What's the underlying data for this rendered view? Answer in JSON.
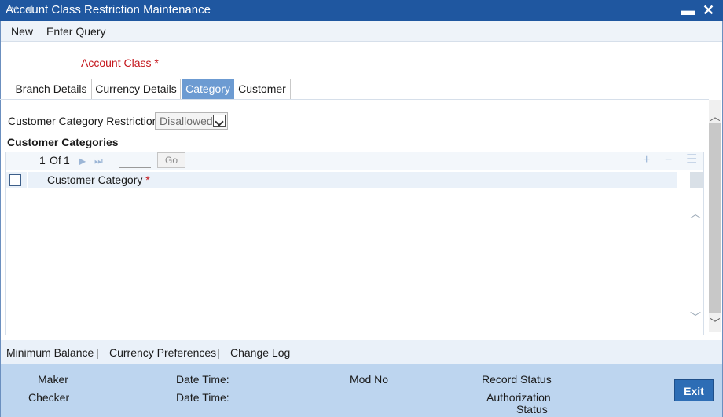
{
  "window": {
    "title": "Account Class Restriction Maintenance",
    "minimize_glyph": "▬",
    "close_glyph": "✕"
  },
  "toolbar": {
    "new_label": "New",
    "enter_query_label": "Enter Query"
  },
  "account_class": {
    "label": "Account Class",
    "required_marker": "*",
    "value": ""
  },
  "tabs": [
    {
      "label": "Branch Details",
      "active": false
    },
    {
      "label": "Currency Details",
      "active": false
    },
    {
      "label": "Category",
      "active": true
    },
    {
      "label": "Customer",
      "active": false
    }
  ],
  "category": {
    "restriction_label": "Customer Category Restriction",
    "restriction_value": "Disallowed",
    "section_title": "Customer Categories",
    "pager": {
      "current_page": "1",
      "of_label": "Of",
      "total_pages": "1",
      "go_label": "Go"
    },
    "grid": {
      "column_label": "Customer Category",
      "required_marker": "*",
      "rows": []
    }
  },
  "footer_links": {
    "minimum_balance": "Minimum Balance",
    "sep": "|",
    "currency_preferences": "Currency Preferences",
    "change_log": "Change Log"
  },
  "audit": {
    "maker_label": "Maker",
    "checker_label": "Checker",
    "date_time_label": "Date Time:",
    "mod_no_label": "Mod No",
    "record_status_label": "Record Status",
    "authorization_label": "Authorization",
    "status_label": "Status",
    "exit_label": "Exit"
  },
  "colors": {
    "title_bar": "#1f57a0",
    "active_tab": "#6c9bd2",
    "audit_panel": "#bdd5ef",
    "required": "#c4161c"
  }
}
